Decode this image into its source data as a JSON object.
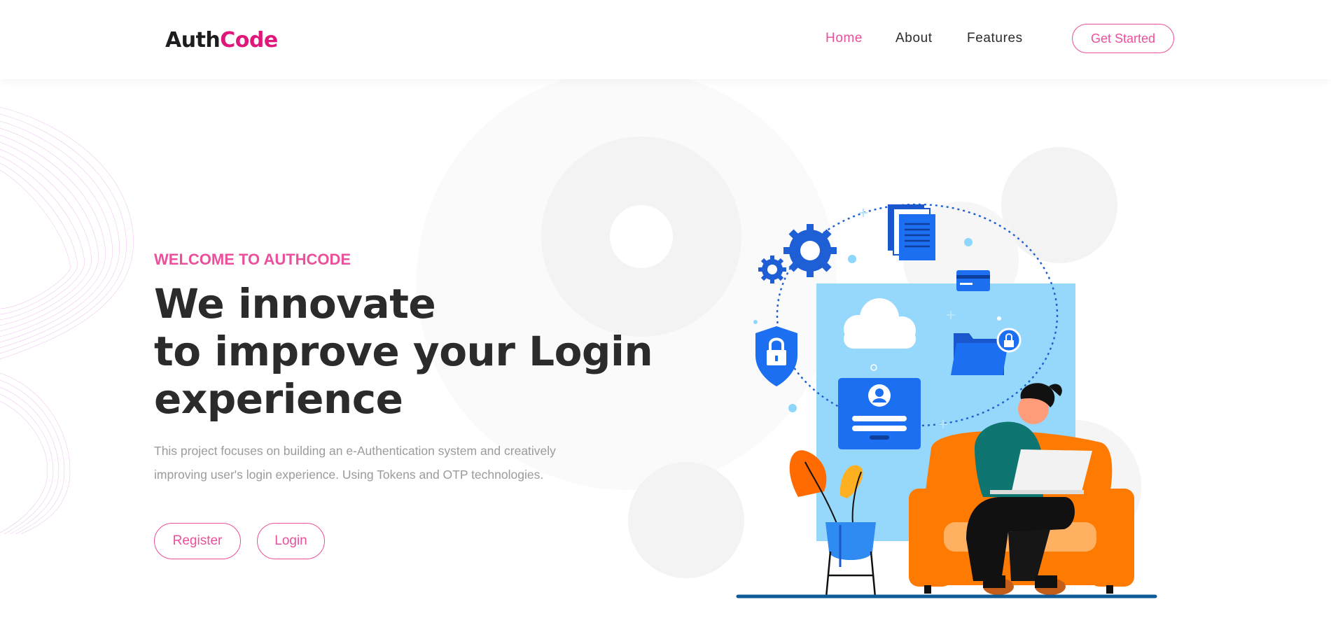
{
  "header": {
    "logo": {
      "part1": "Auth",
      "part2": "Code"
    },
    "nav": [
      {
        "label": "Home",
        "active": true
      },
      {
        "label": "About",
        "active": false
      },
      {
        "label": "Features",
        "active": false
      }
    ],
    "cta_label": "Get Started"
  },
  "hero": {
    "eyebrow": "WELCOME TO AUTHCODE",
    "headline": [
      "We innovate",
      "to improve your Login",
      "experience"
    ],
    "description": [
      "This project focuses on building an e-Authentication system and creatively",
      "improving user's login experience. Using Tokens and OTP technologies."
    ],
    "buttons": {
      "register": "Register",
      "login": "Login"
    }
  },
  "colors": {
    "accent": "#ec4f9b",
    "brand": "#e0177a",
    "text": "#2b2b2b",
    "muted": "#9b9b9b",
    "illustration_blue": "#1565e0",
    "illustration_light_blue": "#96d8fb",
    "illustration_orange": "#ff7a00"
  },
  "icons": [
    "gear-icon",
    "document-icon",
    "credit-card-icon",
    "shield-lock-icon",
    "cloud-icon",
    "folder-lock-icon",
    "user-login-icon"
  ]
}
